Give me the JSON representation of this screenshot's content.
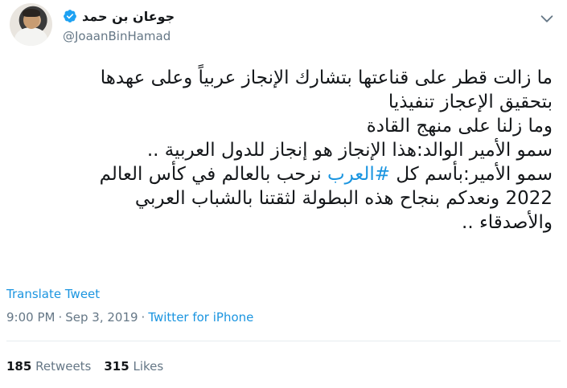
{
  "author": {
    "name": "جوعان بن حمد",
    "handle": "@JoaanBinHamad",
    "verified": true
  },
  "tweet": {
    "lines": [
      "ما زالت قطر على قناعتها بتشارك الإنجاز عربياً وعلى عهدها",
      "بتحقيق الإعجاز تنفيذيا",
      "وما زلنا على منهج القادة",
      "سمو الأمير الوالد:هذا الإنجاز هو إنجاز للدول العربية ..",
      "نرحب بالعالم في كأس العالم",
      "2022 ونعدكم بنجاح هذه البطولة لثقتنا بالشباب العربي",
      "والأصدقاء .."
    ],
    "line5_prefix": "سمو الأمير:بأسم كل ",
    "hashtag": "#العرب"
  },
  "translate_label": "Translate Tweet",
  "meta": {
    "time": "9:00 PM",
    "separator": "·",
    "date": "Sep 3, 2019",
    "source": "Twitter for iPhone"
  },
  "stats": {
    "retweets_count": "185",
    "retweets_label": "Retweets",
    "likes_count": "315",
    "likes_label": "Likes"
  },
  "colors": {
    "link": "#1b95e0",
    "secondary_text": "#657786",
    "verified_badge": "#1da1f2"
  },
  "icons": [
    "verified-badge-icon",
    "chevron-down-icon"
  ]
}
